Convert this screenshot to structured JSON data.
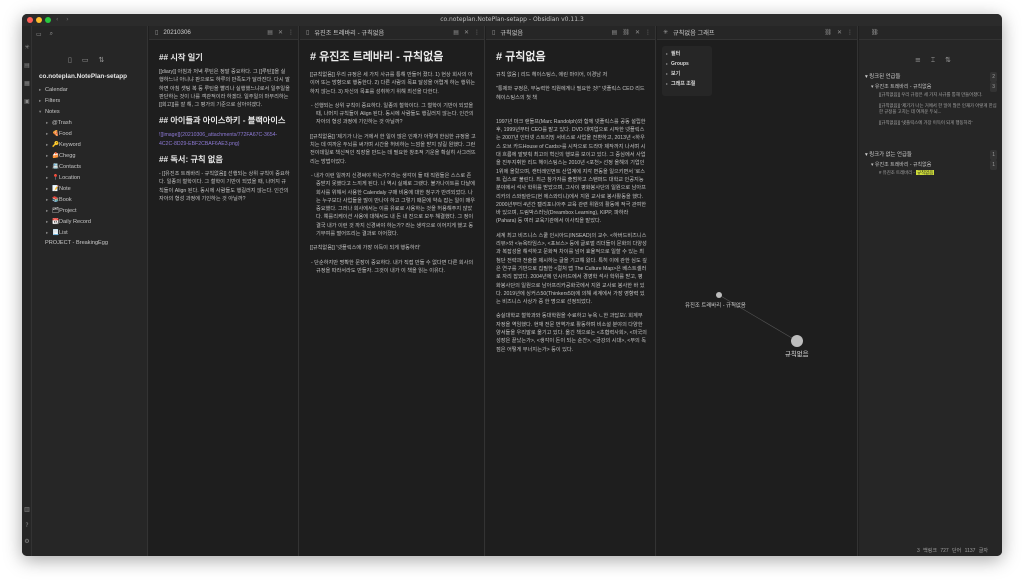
{
  "window": {
    "title": "co.noteplan.NotePlan-setapp - Obsidian v0.11.3"
  },
  "sidebar": {
    "vault_name": "co.noteplan.NotePlan-setapp",
    "tree": [
      {
        "label": "Calendar",
        "level": 0,
        "caret": "▸"
      },
      {
        "label": "Filters",
        "level": 0,
        "caret": "▸"
      },
      {
        "label": "Notes",
        "level": 0,
        "caret": "▾"
      },
      {
        "label": "@Trash",
        "level": 1,
        "caret": "▸"
      },
      {
        "label": "🍕Food",
        "level": 1,
        "caret": "▸"
      },
      {
        "label": "🔑Keyword",
        "level": 1,
        "caret": "▸"
      },
      {
        "label": "🍰Chegg",
        "level": 1,
        "caret": "▸"
      },
      {
        "label": "📇Contacts",
        "level": 1,
        "caret": "▸"
      },
      {
        "label": "📍Location",
        "level": 1,
        "caret": "▸"
      },
      {
        "label": "📝Note",
        "level": 1,
        "caret": "▸"
      },
      {
        "label": "📚Book",
        "level": 1,
        "caret": "▸"
      },
      {
        "label": "🗂Project",
        "level": 1,
        "caret": "▸"
      },
      {
        "label": "📆Daily Record",
        "level": 1,
        "caret": "▸"
      },
      {
        "label": "📃List",
        "level": 1,
        "caret": "▸"
      },
      {
        "label": "PROJECT - BreakingEgg",
        "level": 0,
        "caret": ""
      }
    ]
  },
  "pane1": {
    "tab": "20210306",
    "h_start": "## 시작 일기",
    "p_start_a": "[[diary]] 아침과 저녁 루틴은 정말 중요하다. 그 [[루틴]]을 실행하느냐 아니냐 판으로도 하루의 만족도가 달라진다. 다시 말하면 아침 셋팅 복 등 루틴을 빨리나 실행했느냐로서 일주일을 판단하는 것이 나를 객관적이라 하겠다. 일주일의 마무리하는 [[회고]]를 잘 해, 그 평가의 기준으로 삼아야겠다.",
    "h_idea": "## 아이들과 아이스하키 - 블랙아이스",
    "p_idea": "![[image]](20210306_attachments/772FA67C-3654-4C2C-8D29-EBF2CBAF6AE3.png)",
    "h_book": "## 독서: 규칙 없음",
    "p_book": "- [[유진조 트레바리 - 규칙없음]] 선행되는 상위 규칙이 중요하다. 일종의 철학이다. 그 철학이 기반이 되었을 때, 나머지 규칙들이 Align 된다. 동시에 사람들도 행길러지 않는다. 인간의 자아의 형성 과정에 기인하는 것 아닐까?"
  },
  "pane2": {
    "tab": "유진조 트레바리 - 규칙없음",
    "title": "# 유진조 트레바리 - 규칙없음",
    "p1": "[[규칙없음]] 우리 규정은 세 가지 사규를 통해 만들어 졌다. 1) 현상 회사의 아이어 또는 방향으로 행동한다. 2) 다른 사람의 목표 달성을 어렵게 하는 행위는 하지 않는다. 3) 자신의 목표를 성취하기 위해 최선을 다한다.",
    "b1": "- 선행되는 상위 규칙이 중요하다. 일종의 철학이다. 그 철학이 기반이 되었을 때, 나머지 규칙들이 Align 된다. 동시에 사람들도 행길러지 않는다. 인간의 자아의 형성 과정에 기인하는 것 아닐까?",
    "p2": "[[규칙없음]] '제기가 나는 거에서 한 일이 많은 인재가 아렇게 한심한 규정을 고치는 데 여까운 두뇌를 써가며 시간을 허비하는 느낌을 받지 않길 원했다. 그런 전이데일로 책신적인 직장을 만드는 데 필요한 창조적 기운을 확실히 사그러뜨리는 방법이었다.",
    "b2": "- 내가 이런 일까지 신경써야 하는가? 라는 생각이 들 때 직원들은 스스로 존중받지 못했다고 느끼게 된다. 나 역시 실제로 그랬다. 불가나이트를 다날에 회사를 위해서 사용한 Calendaly 구매 비용에 대한 청구가 반려되었다. 나는 누구보다 사업들을 많이 만나야 하고 그렇기 때문에 약속 잡는 일이 매우 중요했다. 그러나 회사에서는 이를 유료로 사용하는 것을 허용해주지 않았다. 예를리케이션 사용에 대해서도 내 돈 내 진으로 모두 해결했다. 그 정이 결국 내가 이런 것 까지 신경써야 하는가? 라는 생각으로 이어지게 했고 동기부여를 떨어뜨리는 결과로 이어졌다.",
    "p3": "[[규칙없음]] '넷플릭스에 가장 이득이 되게 행동하라'",
    "b3": "- 단순하지만 명확한 문장이 중요하다. 내가 직접 만들 수 없다면 다른 회사의 규정을 따라서라도 만들자. 그것이 내가 이 책을 읽는 이유다."
  },
  "pane3": {
    "tab": "규칙없음",
    "title": "# 규칙없음",
    "meta": "규칙 없음 | 리드 헤이스팅스, 에린 마이어, 이경남 저",
    "quote": "\"통제와 규정은, 무능력한 직원에게나 필요한 것!\" 넷플릭스 CEO 리드 헤이스팅스의 첫 책",
    "p1": "1997년 마크 랜돌프(Marc Randolph)와 함께 넷플릭스를 공동 설립한 후, 1999년부터 CEO를 맡고 있다. DVD 대여업으로 시작한 넷플릭스는 2007년 인터넷 스트리밍 서비스로 사업을 전환하고, 2013년 <하우스 오브 카드House of Cards>를 시작으로 드라마 제작까지 나서며 시대 흐름에 발맞춰 최고의 혁신의 행보를 보이고 있다. 그 중심에서 사업을 진두지휘한 리드 헤이스팅스는 2010년 <포천> 선정 올해의 기업인 1위에 올랐으며, 캔터레인먼트 산업계에 지각 변동을 일으키면서 '로스트 컵스로' 불린다. 최근 참가자를 출범하고 스탠퍼드 대학교 인공지능 분야에서 석사 학위를 받았으며, 그사이 평화봉사단의 일원으로 남아프리카의 스와질란드(현 에스와티니)에서 지원 교사로 봉사활동을 했다. 2000년부터 4년간 캘리포니아주 교육 관련 위원의 활동에 적극 관여한 바 있으며, 드림박스러닝(Dreambox Learning), KIPP, 파하라(Pahara) 등 여러 교육기관에서 이사직을 맡았다.",
    "p2": "세계 최고 비즈니스 스쿨 인시아드(INSEAD)의 교수. <하버드비즈니스리뷰>와 <뉴욕타임스>, <포브스> 등에 글로벌 리더들이 문화의 다양성과 복잡성을 해석하고 문화적 차이를 넘어 효율적으로 일할 수 있는 최첨단 전략과 전술을 제시하는 글을 기고해 왔다. 특히 이에 관한 심도 깊은 연구를 기반으로 집필한 <컬처 맵 The Culture Map>은 베스트셀러로 자리 잡았다. 2004년에 인시아드에서 경영학 석사 학위를 받고, 평화봉사단의 일원으로 남아프리카공화국에서 지원 교사로 봉사한 바 있다. 2019년에 싱커스50(Thinkers50)에 의해 세계에서 가장 영향력 있는 비즈니스 사상가 중 한 명으로 선정되었다.",
    "p3": "숭실대학교 철학과와 동대학원을 수료하고 뉴욕 ㄴ한 과답보/. 회계부 자정을 역임했다. 현재 전문 번역가로 활동하며 비소설 분야의 다양한 양서들을 우리말로 옮기고 있다. 옮긴 책으로는 <초협력사회>, <미국의 성장은 끝났는가>, <생각이 돈이 되는 순간>, <금강의 시대>, <부의 독점은 어떻게 무너지는가> 등이 있다."
  },
  "pane4": {
    "tab": "규칙없음 그래프",
    "menu": [
      "필터",
      "Groups",
      "보기",
      "그래프 조절"
    ],
    "node_a": "유진조 트레바리 - 규칙없음",
    "node_b": "규칙없음"
  },
  "right": {
    "backlinks": {
      "title": "링크된 언급들",
      "count": "2"
    },
    "bl_file": "유진조 트레바리 - 규칙없음",
    "bl_count": "3",
    "bl_snips": [
      "[[규칙없음]] 우리 규정은 세 가지 사규를 통해 만들어졌다.",
      "[[규칙없음]] '제기가 나는 거에서 한 일이 많은 인재가 아렇게 한심한 규정을 고치는 데 여까운 두뇌...",
      "[[규칙없음]] '넷플릭스에 가장 이득이 되게 행동하라'"
    ],
    "unlinked": {
      "title": "링크가 없는 언급들",
      "count": "1"
    },
    "ul_file": "유진조 트레바리 - 규칙없음",
    "ul_count": "1",
    "ul_snip_pre": "# 유진조 트레바리 - ",
    "ul_snip_hl": "규칙없음"
  },
  "status": {
    "backlinks": "3 백링크",
    "words": "727 단어",
    "chars": "1137 글자"
  },
  "colors": {
    "link": "#8e7ad6",
    "highlight": "#cddc39",
    "background": "#1e1e1e"
  }
}
